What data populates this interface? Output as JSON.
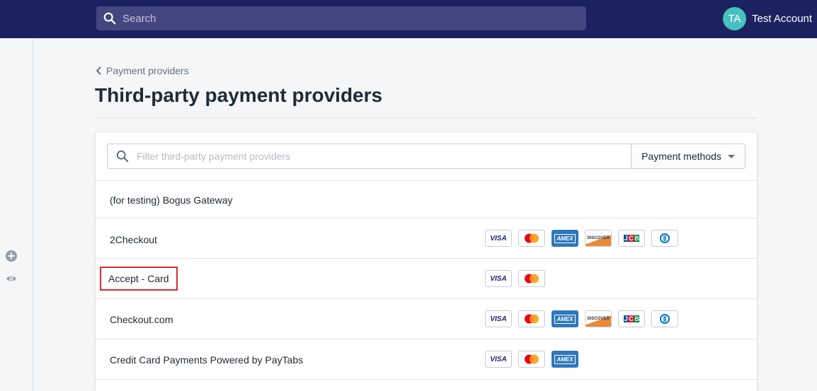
{
  "topbar": {
    "search_placeholder": "Search",
    "account_initials": "TA",
    "account_name": "Test Account"
  },
  "breadcrumb": {
    "label": "Payment providers"
  },
  "page": {
    "title": "Third-party payment providers"
  },
  "filter": {
    "placeholder": "Filter third-party payment providers",
    "methods_label": "Payment methods"
  },
  "card_labels": {
    "visa": "VISA",
    "amex": "AMEX",
    "discover": "DISCOVER",
    "jcb": "JCB"
  },
  "providers": [
    {
      "name": "(for testing) Bogus Gateway",
      "cards": []
    },
    {
      "name": "2Checkout",
      "cards": [
        "visa",
        "mastercard",
        "amex",
        "discover",
        "jcb",
        "diners"
      ]
    },
    {
      "name": "Accept - Card",
      "cards": [
        "visa",
        "mastercard"
      ],
      "highlighted": true
    },
    {
      "name": "Checkout.com",
      "cards": [
        "visa",
        "mastercard",
        "amex",
        "discover",
        "jcb",
        "diners"
      ]
    },
    {
      "name": "Credit Card Payments Powered by PayTabs",
      "cards": [
        "visa",
        "mastercard",
        "amex"
      ]
    }
  ],
  "colors": {
    "topbar": "#1c2260",
    "avatar": "#47c1bf",
    "highlight": "#d82c2c",
    "visa": "#1a1f71",
    "mastercard_red": "#eb001b",
    "mastercard_orange": "#f79e1b",
    "amex": "#2e77bc"
  }
}
